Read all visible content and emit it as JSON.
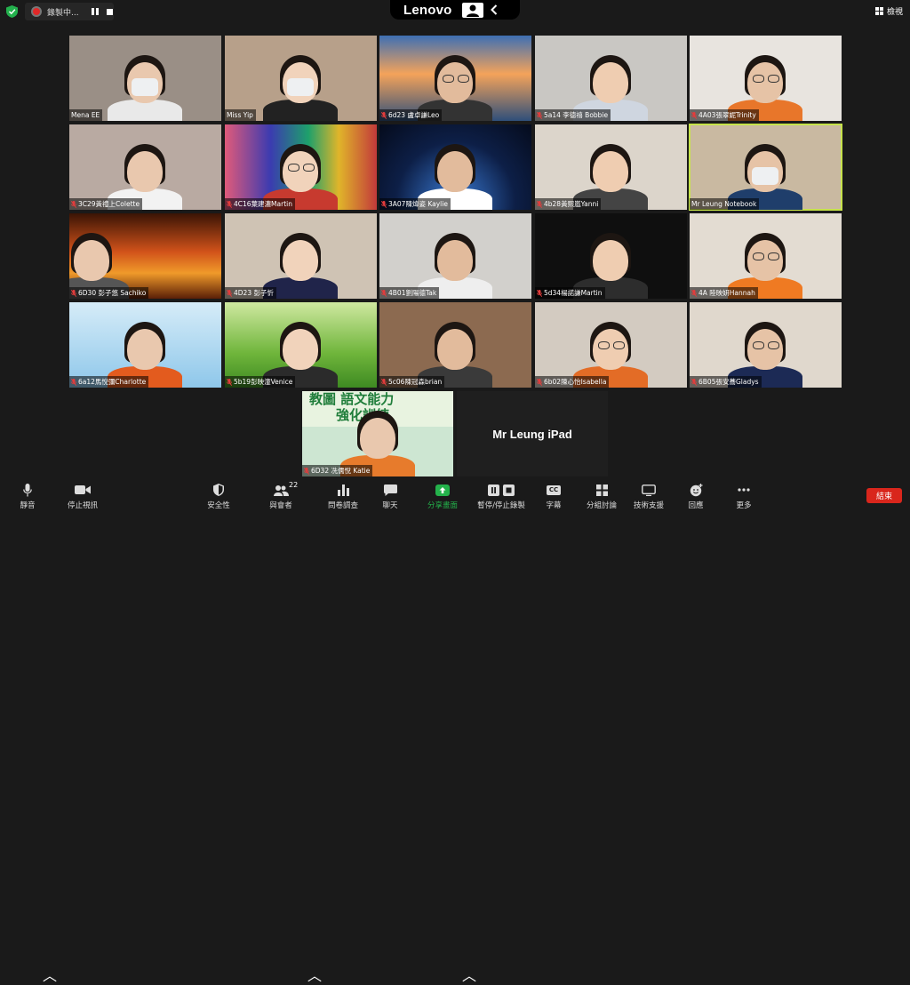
{
  "topbar": {
    "recording_label": "錄製中...",
    "brand": "Lenovo",
    "view_label": "檢視"
  },
  "participants": [
    {
      "name": "Mena EE",
      "muted": false,
      "bg": "#9a8f86"
    },
    {
      "name": "Miss Yip",
      "muted": false,
      "bg": "#b7a08a"
    },
    {
      "name": "6d23 盧卓謙Leo",
      "muted": true,
      "bg": "#d88a4a"
    },
    {
      "name": "5a14 李德禧 Bobbie",
      "muted": true,
      "bg": "#c9c7c3"
    },
    {
      "name": "4A03張翠妮Trinity",
      "muted": true,
      "bg": "#e8e4df"
    },
    {
      "name": "3C29黃禮上Colette",
      "muted": true,
      "bg": "#b9aaa2"
    },
    {
      "name": "4C16葉建濃Martin",
      "muted": true,
      "bg": "#2c2a3a"
    },
    {
      "name": "3A07陳煒姿 Kaylie",
      "muted": true,
      "bg": "#1f3a6e"
    },
    {
      "name": "4b28黃熙嵐Yanni",
      "muted": true,
      "bg": "#dcd5cb"
    },
    {
      "name": "Mr Leung Notebook",
      "muted": false,
      "bg": "#c9b9a1"
    },
    {
      "name": "6D30 彭子悠 Sachiko",
      "muted": true,
      "bg": "#b8421a"
    },
    {
      "name": "4D23 彭子忻",
      "muted": true,
      "bg": "#cfc3b4"
    },
    {
      "name": "4B01劉陽德Tak",
      "muted": true,
      "bg": "#d2d0cc"
    },
    {
      "name": "5d34楊諾謙Martin",
      "muted": true,
      "bg": "#0f0f0f"
    },
    {
      "name": "4A 陸映妍Hannah",
      "muted": true,
      "bg": "#e3dcd2"
    },
    {
      "name": "6a12馬悅彌Charlotte",
      "muted": true,
      "bg": "#a9d5ee"
    },
    {
      "name": "5b19彭映潼Venice",
      "muted": true,
      "bg": "#7fb64a"
    },
    {
      "name": "5c06陳冠森brian",
      "muted": true,
      "bg": "#8c6a50"
    },
    {
      "name": "6b02陳心怡Isabella",
      "muted": true,
      "bg": "#d3cbc1"
    },
    {
      "name": "6B05張安蕎Gladys",
      "muted": true,
      "bg": "#e0d8cd"
    },
    {
      "name": "6D32 冼儒悅 Katie",
      "muted": true,
      "bg": "#cde6d2"
    }
  ],
  "katie_banner": {
    "line1": "教圖 語文能力",
    "line2": "強化訓練"
  },
  "ipad_tile": {
    "name": "Mr Leung iPad"
  },
  "toolbar": {
    "mute": "靜音",
    "stop_video": "停止視訊",
    "security": "安全性",
    "participants": "與會者",
    "participant_count": "22",
    "polls": "問卷調查",
    "chat": "聊天",
    "share_screen": "分享畫面",
    "pause_record": "暫停/停止錄製",
    "captions": "字幕",
    "breakout": "分組討論",
    "tech_support": "技術支援",
    "reactions": "回應",
    "more": "更多",
    "end": "結束",
    "cc_icon_text": "CC"
  },
  "colors": {
    "active_speaker_border": "#c6e34a",
    "share_green": "#24b24b",
    "end_red": "#d9261c",
    "mute_red": "#e23c3c"
  }
}
